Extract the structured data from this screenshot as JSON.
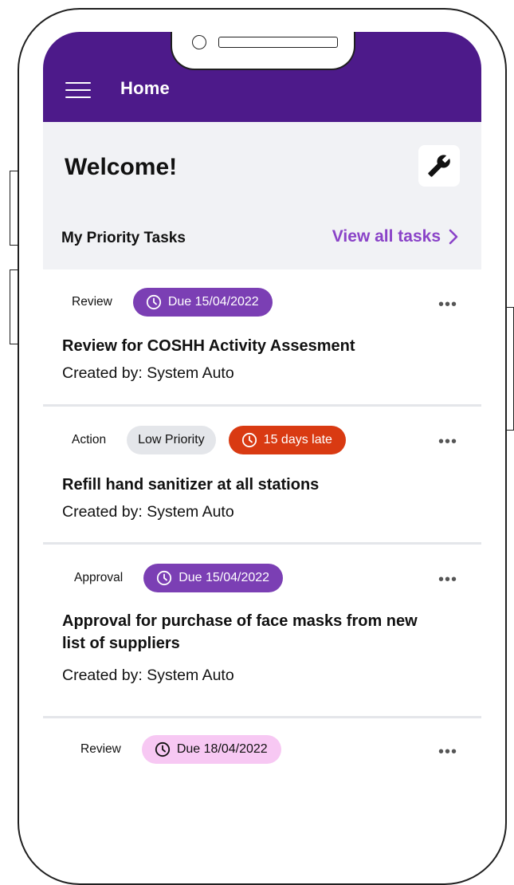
{
  "header": {
    "title": "Home",
    "menu_icon": "hamburger-menu-icon",
    "background": "#4d1a8a"
  },
  "welcome": {
    "title": "Welcome!",
    "settings_icon": "wrench-icon"
  },
  "priority_tasks": {
    "heading": "My Priority Tasks",
    "view_all_label": "View all tasks",
    "accent": "#8a43c8"
  },
  "tasks": [
    {
      "type": "Review",
      "badges": [
        {
          "kind": "due",
          "text": "Due 15/04/2022",
          "icon": "clock-icon",
          "color": "#7b3fb4"
        }
      ],
      "title": "Review for COSHH Activity Assesment",
      "creator": "Created by: System Auto"
    },
    {
      "type": "Action",
      "badges": [
        {
          "kind": "priority",
          "text": "Low Priority"
        },
        {
          "kind": "late",
          "text": "15 days late",
          "icon": "clock-icon",
          "color": "#d93a12"
        }
      ],
      "title": "Refill hand sanitizer at all stations",
      "creator": "Created by: System Auto"
    },
    {
      "type": "Approval",
      "badges": [
        {
          "kind": "due",
          "text": "Due 15/04/2022",
          "icon": "clock-icon",
          "color": "#7b3fb4"
        }
      ],
      "title": "Approval for purchase of face masks from new list of suppliers",
      "creator": "Created by: System Auto"
    },
    {
      "type": "Review",
      "badges": [
        {
          "kind": "due-pink",
          "text": "Due 18/04/2022",
          "icon": "clock-icon",
          "color": "#f7c8f3"
        }
      ],
      "title": "",
      "creator": ""
    }
  ],
  "more_icon": "more-horizontal-icon"
}
